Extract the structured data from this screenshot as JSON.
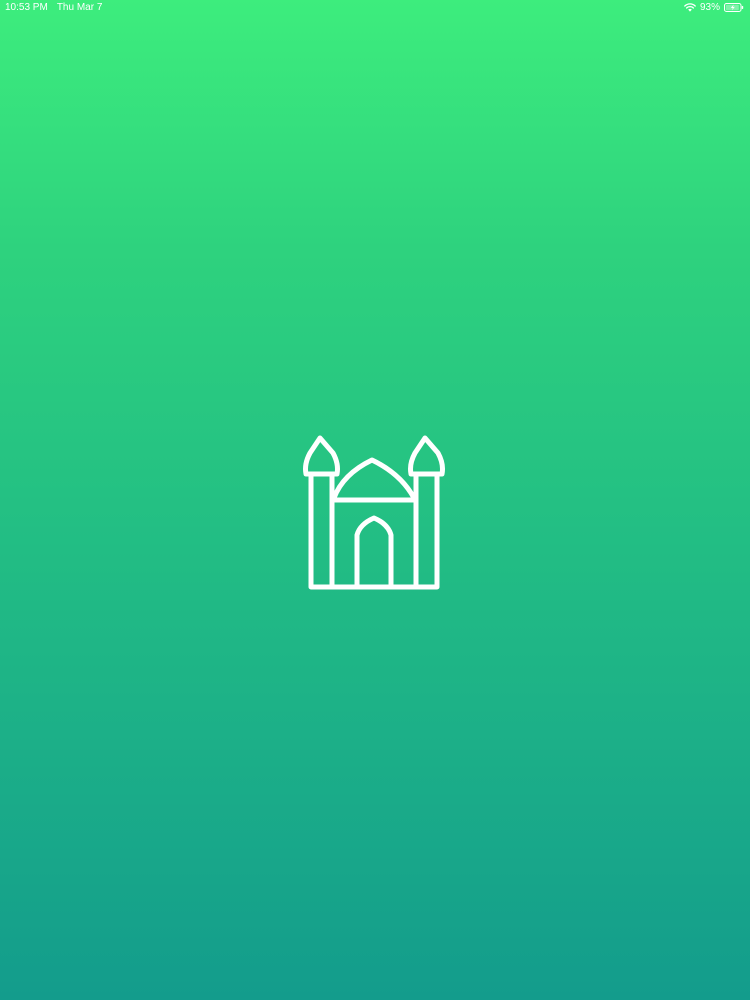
{
  "status_bar": {
    "time": "10:53 PM",
    "date": "Thu Mar 7",
    "battery_percent": "93%",
    "battery_level": 0.93,
    "wifi_icon": "wifi-icon",
    "battery_icon": "battery-charging-icon"
  },
  "splash": {
    "logo_icon": "mosque-icon",
    "background_top_color": "#3ded7d",
    "background_bottom_color": "#139c8c",
    "icon_color": "#ffffff"
  }
}
